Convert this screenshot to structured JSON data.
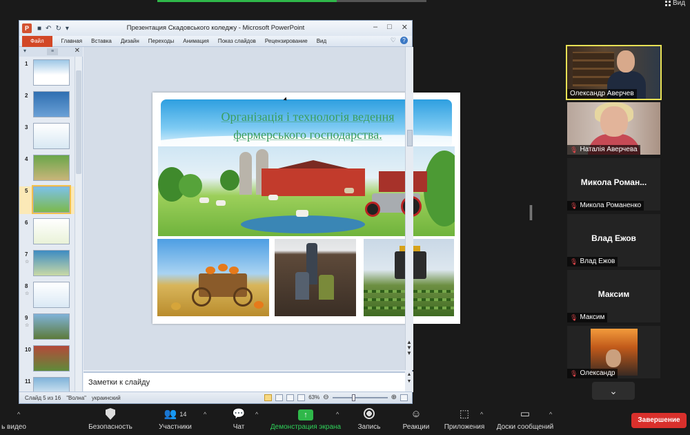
{
  "top": {
    "view_label": "Вид"
  },
  "ppt": {
    "logo": "P",
    "window_title": "Презентация Скадовського коледжу - Microsoft PowerPoint",
    "tabs": [
      "Файл",
      "Главная",
      "Вставка",
      "Дизайн",
      "Переходы",
      "Анимация",
      "Показ слайдов",
      "Рецензирование",
      "Вид"
    ],
    "thumb_numbers": [
      "1",
      "2",
      "3",
      "4",
      "5",
      "6",
      "7",
      "8",
      "9",
      "10",
      "11"
    ],
    "active_slide": 5,
    "slide": {
      "title_line1": "Організація і технологія ведення",
      "title_line2": "фермерського господарства."
    },
    "notes_placeholder": "Заметки к слайду",
    "status": {
      "slide_of": "Слайд 5 из 16",
      "theme": "\"Волна\"",
      "language": "украинский",
      "zoom": "63%"
    }
  },
  "participants": [
    {
      "name": "Олександр Аверчев",
      "video": true,
      "muted": false,
      "active": true
    },
    {
      "name": "Наталія Аверчева",
      "video": true,
      "muted": true
    },
    {
      "display": "Микола  Роман...",
      "name": "Микола Романенко",
      "video": false,
      "muted": true
    },
    {
      "display": "Влад Ежов",
      "name": "Влад Ежов",
      "video": false,
      "muted": true
    },
    {
      "display": "Максим",
      "name": "Максим",
      "video": false,
      "muted": true
    },
    {
      "name": "Олександр",
      "video": false,
      "avatar": true,
      "muted": true
    }
  ],
  "toolbar": {
    "video_label": "ь видео",
    "security_label": "Безопасность",
    "participants_label": "Участники",
    "participants_count": "14",
    "chat_label": "Чат",
    "share_label": "Демонстрация экрана",
    "record_label": "Запись",
    "reactions_label": "Реакции",
    "apps_label": "Приложения",
    "whiteboard_label": "Доски сообщений",
    "end_label": "Завершение"
  },
  "colors": {
    "share_green": "#2fb84a",
    "end_red": "#d9302c",
    "active_speaker": "#e9e255",
    "ppt_file_tab": "#d24726"
  }
}
